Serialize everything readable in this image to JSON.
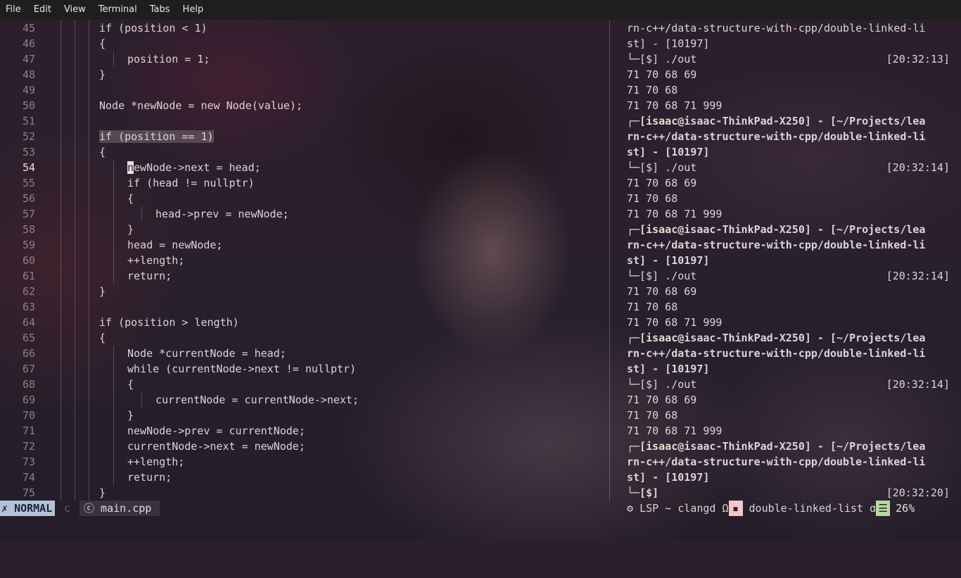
{
  "menu": {
    "items": [
      "File",
      "Edit",
      "View",
      "Terminal",
      "Tabs",
      "Help"
    ]
  },
  "editor": {
    "lines": [
      {
        "n": "45",
        "code": "if (position < 1)"
      },
      {
        "n": "46",
        "code": "{"
      },
      {
        "n": "47",
        "code": "position = 1;"
      },
      {
        "n": "48",
        "code": "}"
      },
      {
        "n": "49",
        "code": ""
      },
      {
        "n": "50",
        "code": "Node *newNode = new Node(value);"
      },
      {
        "n": "51",
        "code": ""
      },
      {
        "n": "52",
        "code": "if (position == 1)"
      },
      {
        "n": "53",
        "code": "{"
      },
      {
        "n": "54",
        "code": "newNode->next = head;"
      },
      {
        "n": "55",
        "code": "if (head != nullptr)"
      },
      {
        "n": "56",
        "code": "{"
      },
      {
        "n": "57",
        "code": "head->prev = newNode;"
      },
      {
        "n": "58",
        "code": "}"
      },
      {
        "n": "59",
        "code": "head = newNode;"
      },
      {
        "n": "60",
        "code": "++length;"
      },
      {
        "n": "61",
        "code": "return;"
      },
      {
        "n": "62",
        "code": "}"
      },
      {
        "n": "63",
        "code": ""
      },
      {
        "n": "64",
        "code": "if (position > length)"
      },
      {
        "n": "65",
        "code": "{"
      },
      {
        "n": "66",
        "code": "Node *currentNode = head;"
      },
      {
        "n": "67",
        "code": "while (currentNode->next != nullptr)"
      },
      {
        "n": "68",
        "code": "{"
      },
      {
        "n": "69",
        "code": "currentNode = currentNode->next;"
      },
      {
        "n": "70",
        "code": "}"
      },
      {
        "n": "71",
        "code": "newNode->prev = currentNode;"
      },
      {
        "n": "72",
        "code": "currentNode->next = newNode;"
      },
      {
        "n": "73",
        "code": "++length;"
      },
      {
        "n": "74",
        "code": "return;"
      },
      {
        "n": "75",
        "code": "}"
      }
    ]
  },
  "terminal": {
    "top_lines": [
      "rn-c++/data-structure-with-cpp/double-linked-li",
      "st] - [10197]"
    ],
    "blocks": [
      {
        "cmd": "└─[$] ./out",
        "time": "[20:32:13]",
        "out": [
          "71 70 68 69",
          "71 70 68",
          "71 70 68 71 999"
        ]
      },
      {
        "cmd": "└─[$] ./out",
        "time": "[20:32:14]",
        "out": [
          "71 70 68 69",
          "71 70 68",
          "71 70 68 71 999"
        ]
      },
      {
        "cmd": "└─[$] ./out",
        "time": "[20:32:14]",
        "out": [
          "71 70 68 69",
          "71 70 68",
          "71 70 68 71 999"
        ]
      },
      {
        "cmd": "└─[$] ./out",
        "time": "[20:32:14]",
        "out": [
          "71 70 68 69",
          "71 70 68",
          "71 70 68 71 999"
        ]
      }
    ],
    "prompt": {
      "corner": "┌─[",
      "user": "isaac",
      "host": "@isaac-ThinkPad-X250] - [~/Projects/lea",
      "path2": "rn-c++/data-structure-with-cpp/double-linked-li",
      "path3": "st] - [10197]"
    },
    "last_cmd": "└─[$]",
    "last_time": "[20:32:20]"
  },
  "status": {
    "mode": "NORMAL",
    "file_icon": "ⓒ",
    "file": "main.cpp",
    "lsp": "LSP ~ clangd",
    "dir": "double-linked-list",
    "percent": "26%"
  }
}
